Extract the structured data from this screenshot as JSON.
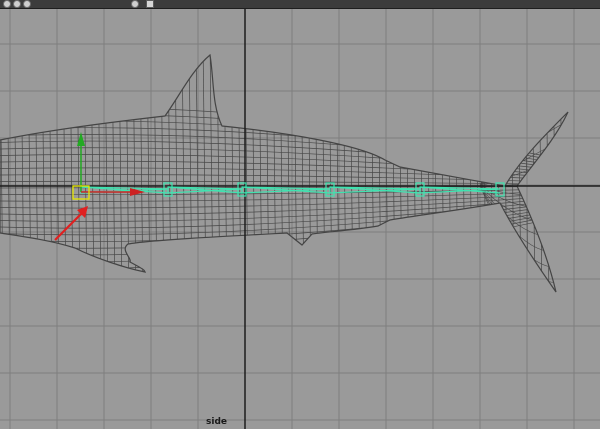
{
  "viewport": {
    "camera_name": "side",
    "background_color": "#9a9a9a",
    "grid_color": "#7e7e7e",
    "axis_color": "#1c1c1c",
    "mesh_color": "#474747",
    "joint_color": "#3fe3b0",
    "selection_color": "#e6e600",
    "annotation_arrow_color": "#e02020"
  },
  "toolbar": {
    "icons": [
      "display-mode-icon",
      "shading-icon",
      "wireframe-icon",
      "camera-icon",
      "isolate-icon"
    ]
  },
  "manipulator": {
    "x_axis_color": "#cc2222",
    "y_axis_color": "#22aa22"
  }
}
